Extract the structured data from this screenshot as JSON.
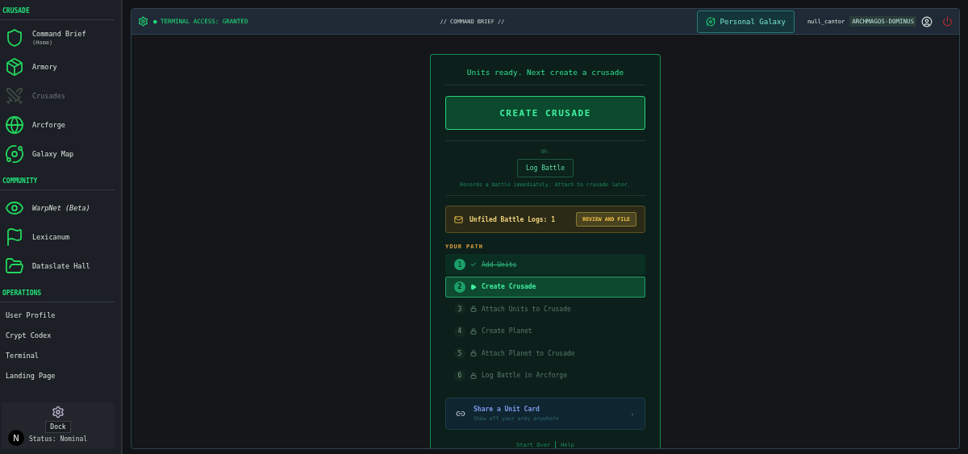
{
  "sidebar": {
    "sections": [
      {
        "title": "CRUSADE",
        "items": [
          {
            "label": "Command Brief",
            "sublabel": "(Home)",
            "disabled": false,
            "italic": false
          },
          {
            "label": "Armory",
            "disabled": false,
            "italic": false
          },
          {
            "label": "Crusades",
            "disabled": true,
            "italic": false
          },
          {
            "label": "Arcforge",
            "disabled": false,
            "italic": false
          },
          {
            "label": "Galaxy Map",
            "disabled": false,
            "italic": false
          }
        ]
      },
      {
        "title": "COMMUNITY",
        "items": [
          {
            "label": "WarpNet (Beta)",
            "disabled": false,
            "italic": true
          },
          {
            "label": "Lexicanum",
            "disabled": false,
            "italic": false
          },
          {
            "label": "Dataslate Hall",
            "disabled": false,
            "italic": false
          }
        ]
      }
    ],
    "operations": {
      "title": "OPERATIONS",
      "links": [
        "User Profile",
        "Crypt Codex",
        "Terminal",
        "Landing Page"
      ]
    },
    "dock": {
      "button": "Dock",
      "status": "Status: Nominal",
      "badge": "N"
    }
  },
  "header": {
    "access": "● TERMINAL ACCESS: GRANTED",
    "title": "// COMMAND BRIEF //",
    "galaxy_button": "Personal Galaxy",
    "username": "null_cantor",
    "role": "ARCHMAGOS-DOMINUS"
  },
  "brief": {
    "heading": "Units ready. Next create a crusade",
    "primary_button": "CREATE CRUSADE",
    "or": "OR:",
    "secondary_button": "Log Battle",
    "note": "Records a battle immediately. Attach to crusade later.",
    "alert": {
      "text": "Unfiled Battle Logs: 1",
      "button": "REVIEW AND FILE"
    },
    "path_title": "YOUR PATH",
    "steps": [
      {
        "number": "1",
        "label": "Add Units",
        "kind": "done"
      },
      {
        "number": "2",
        "label": "Create Crusade",
        "kind": "current"
      },
      {
        "number": "3",
        "label": "Attach Units to Crusade",
        "kind": "locked"
      },
      {
        "number": "4",
        "label": "Create Planet",
        "kind": "locked"
      },
      {
        "number": "5",
        "label": "Attach Planet to Crusade",
        "kind": "locked"
      },
      {
        "number": "6",
        "label": "Log Battle in Arcforge",
        "kind": "locked"
      }
    ],
    "share": {
      "title": "Share a Unit Card",
      "subtitle": "Show off your army anywhere",
      "chevron": "›"
    },
    "footer": [
      "Start Over",
      "Help"
    ]
  }
}
